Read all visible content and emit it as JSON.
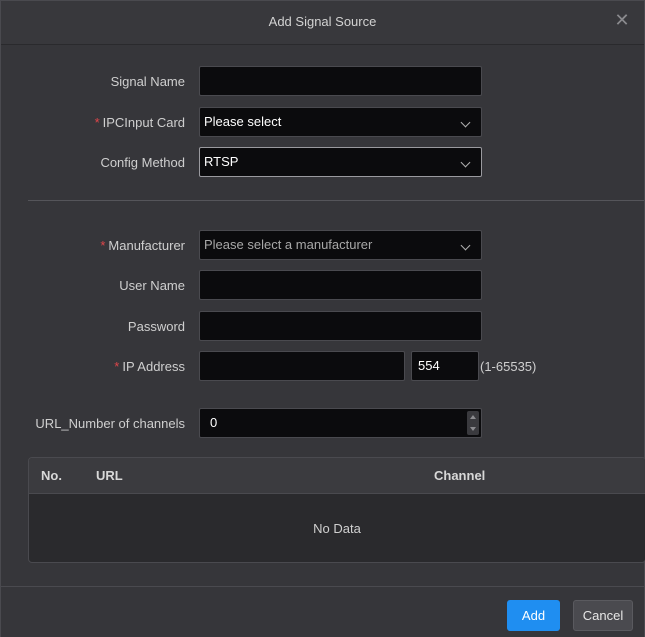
{
  "dialog": {
    "title": "Add Signal Source",
    "close_icon": "close-icon"
  },
  "form": {
    "signal_name": {
      "label": "Signal Name",
      "value": ""
    },
    "ipc_input_card": {
      "label": "IPCInput Card",
      "value": "Please select",
      "required": true
    },
    "config_method": {
      "label": "Config Method",
      "value": "RTSP"
    },
    "manufacturer": {
      "label": "Manufacturer",
      "placeholder": "Please select a manufacturer",
      "required": true
    },
    "user_name": {
      "label": "User Name",
      "value": ""
    },
    "password": {
      "label": "Password",
      "value": ""
    },
    "ip_address": {
      "label": "IP Address",
      "value": "",
      "port": "554",
      "port_range": "(1-65535)",
      "required": true
    },
    "url_channels": {
      "label": "URL_Number of channels",
      "value": "0"
    }
  },
  "table": {
    "columns": [
      "No.",
      "URL",
      "Channel"
    ],
    "empty_text": "No Data"
  },
  "footer": {
    "add_label": "Add",
    "cancel_label": "Cancel"
  },
  "colors": {
    "accent": "#1f8ef1",
    "required": "#e0464a",
    "background": "#36363a"
  }
}
